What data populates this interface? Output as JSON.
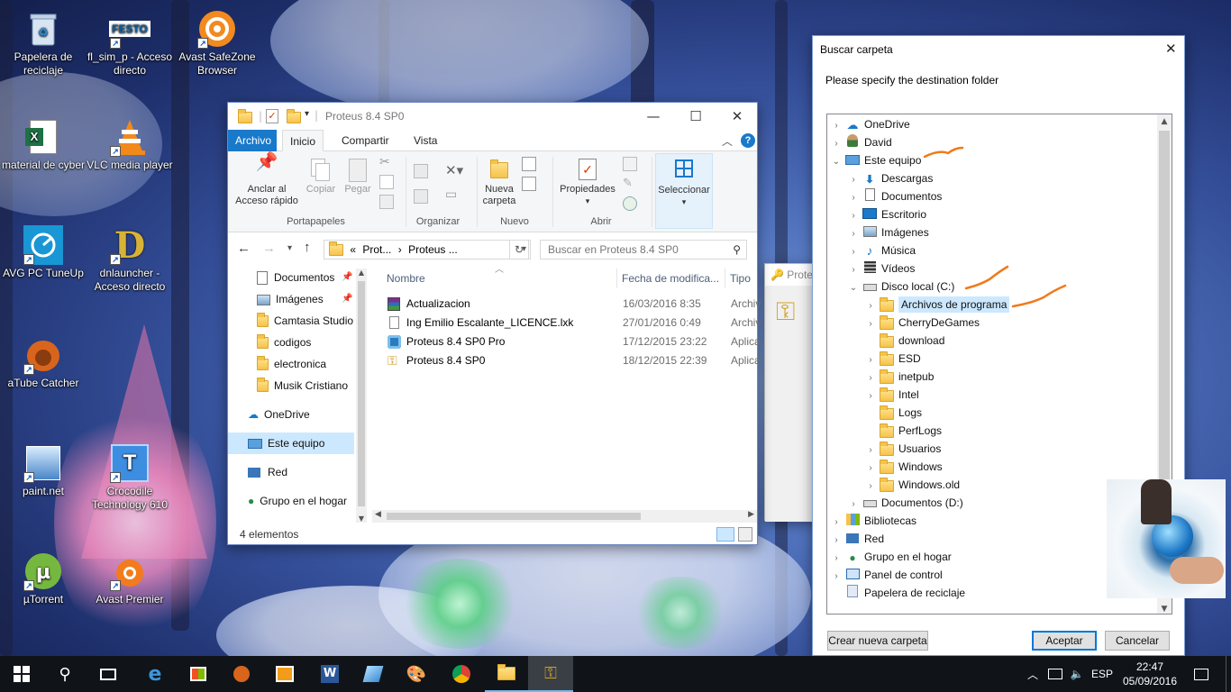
{
  "desktop": {
    "icons": [
      {
        "label": "Papelera de reciclaje"
      },
      {
        "label": "fl_sim_p - Acceso directo",
        "badge": "FESTO"
      },
      {
        "label": "Avast SafeZone Browser"
      },
      {
        "label": "material de cyber",
        "badge": "X"
      },
      {
        "label": "VLC media player"
      },
      {
        "label": "AVG PC TuneUp"
      },
      {
        "label": "dnlauncher - Acceso directo",
        "badge": "D"
      },
      {
        "label": "aTube Catcher"
      },
      {
        "label": "paint.net"
      },
      {
        "label": "Crocodile Technology 610",
        "badge": "T"
      },
      {
        "label": "µTorrent"
      },
      {
        "label": "Avast Premier"
      }
    ]
  },
  "explorer": {
    "title": "Proteus 8.4 SP0",
    "tabs": [
      "Archivo",
      "Inicio",
      "Compartir",
      "Vista"
    ],
    "ribbon": {
      "pin": "Anclar al Acceso rápido",
      "copy": "Copiar",
      "paste": "Pegar",
      "group_clipboard": "Portapapeles",
      "group_organize": "Organizar",
      "new_folder": "Nueva carpeta",
      "group_new": "Nuevo",
      "properties": "Propiedades",
      "group_open": "Abrir",
      "select": "Seleccionar"
    },
    "breadcrumb": {
      "overflow": "«",
      "part1": "Prot...",
      "sep": "›",
      "part2": "Proteus ..."
    },
    "search_placeholder": "Buscar en Proteus 8.4 SP0",
    "nav": [
      {
        "label": "Documentos"
      },
      {
        "label": "Imágenes"
      },
      {
        "label": "Camtasia Studio"
      },
      {
        "label": "codigos"
      },
      {
        "label": "electronica"
      },
      {
        "label": "Musik Cristiano"
      },
      {
        "label": "OneDrive"
      },
      {
        "label": "Este equipo"
      },
      {
        "label": "Red"
      },
      {
        "label": "Grupo en el hogar"
      }
    ],
    "columns": {
      "name": "Nombre",
      "date": "Fecha de modifica...",
      "type": "Tipo"
    },
    "files": [
      {
        "name": "Actualizacion",
        "date": "16/03/2016 8:35",
        "type": "Archiv"
      },
      {
        "name": "Ing Emilio Escalante_LICENCE.lxk",
        "date": "27/01/2016 0:49",
        "type": "Archiv"
      },
      {
        "name": "Proteus 8.4 SP0 Pro",
        "date": "17/12/2015 23:22",
        "type": "Aplica"
      },
      {
        "name": "Proteus 8.4 SP0",
        "date": "18/12/2015 22:39",
        "type": "Aplica"
      }
    ],
    "status": "4 elementos"
  },
  "behind_window": {
    "title": "Prote"
  },
  "dialog": {
    "title": "Buscar carpeta",
    "prompt": "Please specify the destination folder",
    "tree": [
      {
        "label": "OneDrive"
      },
      {
        "label": "David"
      },
      {
        "label": "Este equipo"
      },
      {
        "label": "Descargas"
      },
      {
        "label": "Documentos"
      },
      {
        "label": "Escritorio"
      },
      {
        "label": "Imágenes"
      },
      {
        "label": "Música"
      },
      {
        "label": "Vídeos"
      },
      {
        "label": "Disco local (C:)"
      },
      {
        "label": "Archivos de programa"
      },
      {
        "label": "CherryDeGames"
      },
      {
        "label": "download"
      },
      {
        "label": "ESD"
      },
      {
        "label": "inetpub"
      },
      {
        "label": "Intel"
      },
      {
        "label": "Logs"
      },
      {
        "label": "PerfLogs"
      },
      {
        "label": "Usuarios"
      },
      {
        "label": "Windows"
      },
      {
        "label": "Windows.old"
      },
      {
        "label": "Documentos (D:)"
      },
      {
        "label": "Bibliotecas"
      },
      {
        "label": "Red"
      },
      {
        "label": "Grupo en el hogar"
      },
      {
        "label": "Panel de control"
      },
      {
        "label": "Papelera de reciclaje"
      }
    ],
    "new_folder_button": "Crear nueva carpeta",
    "ok_button": "Aceptar",
    "cancel_button": "Cancelar",
    "annotation_color": "#f07a1a"
  },
  "taskbar": {
    "language": "ESP",
    "time": "22:47",
    "date": "05/09/2016"
  },
  "colors": {
    "accent": "#1979ca",
    "selection": "#cce8ff",
    "taskbar": "#101418"
  }
}
